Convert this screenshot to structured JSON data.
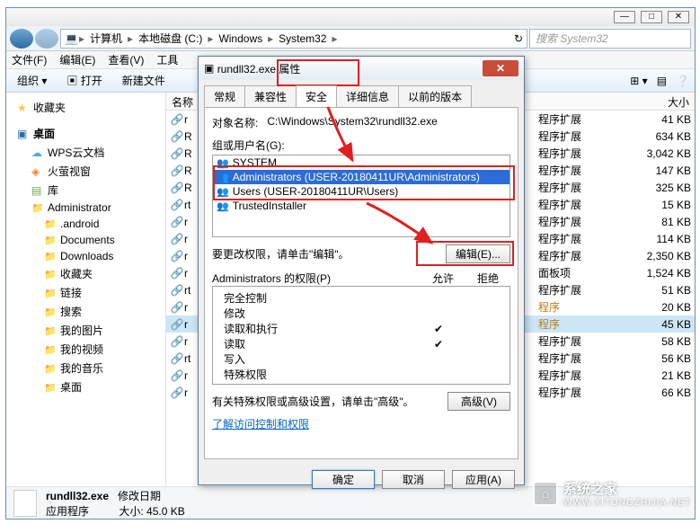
{
  "explorer": {
    "address": {
      "segments": [
        "计算机",
        "本地磁盘 (C:)",
        "Windows",
        "System32"
      ]
    },
    "search_placeholder": "搜索 System32",
    "menus": [
      "文件(F)",
      "编辑(E)",
      "查看(V)",
      "工具"
    ],
    "toolbar": {
      "organize": "组织 ▾",
      "open": "打开",
      "newfile": "新建文件"
    },
    "nav": {
      "favorites": "收藏夹",
      "desktop": "桌面",
      "wps": "WPS云文档",
      "huoying": "火萤视窗",
      "library": "库",
      "items": [
        "Administrator",
        ".android",
        "Documents",
        "Downloads",
        "收藏夹",
        "链接",
        "搜索",
        "我的图片",
        "我的视频",
        "我的音乐",
        "桌面"
      ]
    },
    "columns": {
      "name": "名称",
      "type": "",
      "size": "大小"
    },
    "files": [
      {
        "name": "r",
        "type": "程序扩展",
        "size": "41 KB"
      },
      {
        "name": "R",
        "type": "程序扩展",
        "size": "634 KB"
      },
      {
        "name": "R",
        "type": "程序扩展",
        "size": "3,042 KB"
      },
      {
        "name": "R",
        "type": "程序扩展",
        "size": "147 KB"
      },
      {
        "name": "R",
        "type": "程序扩展",
        "size": "325 KB"
      },
      {
        "name": "rt",
        "type": "程序扩展",
        "size": "15 KB"
      },
      {
        "name": "r",
        "type": "程序扩展",
        "size": "81 KB"
      },
      {
        "name": "r",
        "type": "程序扩展",
        "size": "114 KB"
      },
      {
        "name": "r",
        "type": "程序扩展",
        "size": "2,350 KB"
      },
      {
        "name": "r",
        "type": "面板项",
        "size": "1,524 KB"
      },
      {
        "name": "rt",
        "type": "程序扩展",
        "size": "51 KB"
      },
      {
        "name": "r",
        "type": "程序",
        "size": "20 KB",
        "hot": true
      },
      {
        "name": "r",
        "type": "程序",
        "size": "45 KB",
        "sel": true,
        "hot": true
      },
      {
        "name": "r",
        "type": "程序扩展",
        "size": "58 KB"
      },
      {
        "name": "rt",
        "type": "程序扩展",
        "size": "56 KB"
      },
      {
        "name": "r",
        "type": "程序扩展",
        "size": "21 KB"
      },
      {
        "name": "r",
        "type": "程序扩展",
        "size": "66 KB"
      }
    ],
    "status": {
      "filename": "rundll32.exe",
      "moddate_label": "修改日期",
      "filetype": "应用程序",
      "size_label": "大小:",
      "size_value": "45.0 KB"
    }
  },
  "props": {
    "title": "rundll32.exe 属性",
    "tabs": [
      "常规",
      "兼容性",
      "安全",
      "详细信息",
      "以前的版本"
    ],
    "active_tab": 2,
    "object_label": "对象名称:",
    "object_value": "C:\\Windows\\System32\\rundll32.exe",
    "group_label": "组或用户名(G):",
    "users": [
      {
        "name": "SYSTEM"
      },
      {
        "name": "Administrators (USER-20180411UR\\Administrators)",
        "sel": true
      },
      {
        "name": "Users (USER-20180411UR\\Users)"
      },
      {
        "name": "TrustedInstaller"
      }
    ],
    "edit_hint": "要更改权限，请单击\"编辑\"。",
    "edit_btn": "编辑(E)...",
    "perm_header": "Administrators 的权限(P)",
    "perm_allow": "允许",
    "perm_deny": "拒绝",
    "perms": [
      {
        "name": "完全控制",
        "allow": false,
        "deny": false
      },
      {
        "name": "修改",
        "allow": false,
        "deny": false
      },
      {
        "name": "读取和执行",
        "allow": true,
        "deny": false
      },
      {
        "name": "读取",
        "allow": true,
        "deny": false
      },
      {
        "name": "写入",
        "allow": false,
        "deny": false
      },
      {
        "name": "特殊权限",
        "allow": false,
        "deny": false
      }
    ],
    "adv_hint": "有关特殊权限或高级设置，请单击\"高级\"。",
    "adv_btn": "高级(V)",
    "learn_link": "了解访问控制和权限",
    "ok": "确定",
    "cancel": "取消",
    "apply": "应用(A)"
  },
  "watermark": {
    "line1": "系统之家",
    "line2": "WWW.XITONGZHIJIA.NET"
  }
}
